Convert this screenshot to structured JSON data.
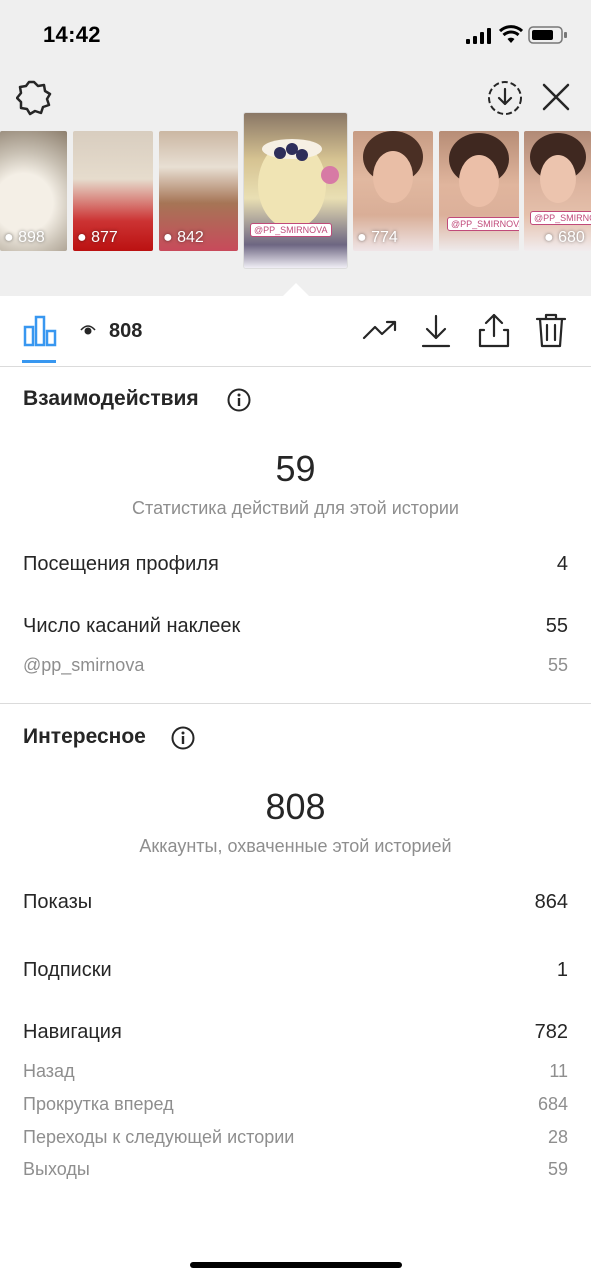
{
  "status_bar": {
    "time": "14:42"
  },
  "thumbnails": [
    {
      "views": "898"
    },
    {
      "views": "877"
    },
    {
      "views": "842"
    },
    {
      "views": "",
      "sticker": "@PP_SMIRNOVA",
      "selected": true
    },
    {
      "views": "774"
    },
    {
      "views": "",
      "sticker": "@PP_SMIRNOVA"
    },
    {
      "views": "680",
      "sticker": "@PP_SMIRNOVA"
    }
  ],
  "toolbar": {
    "view_count": "808"
  },
  "interactions": {
    "title": "Взаимодействия",
    "total": "59",
    "subtitle": "Статистика действий для этой истории",
    "rows": [
      {
        "label": "Посещения профиля",
        "value": "4"
      },
      {
        "label": "Число касаний наклеек",
        "value": "55"
      }
    ],
    "sub_rows": [
      {
        "label": "@pp_smirnova",
        "value": "55"
      }
    ]
  },
  "discovery": {
    "title": "Интересное",
    "total": "808",
    "subtitle": "Аккаунты, охваченные этой историей",
    "rows": [
      {
        "label": "Показы",
        "value": "864"
      },
      {
        "label": "Подписки",
        "value": "1"
      },
      {
        "label": "Навигация",
        "value": "782"
      }
    ],
    "sub_rows": [
      {
        "label": "Назад",
        "value": "11"
      },
      {
        "label": "Прокрутка вперед",
        "value": "684"
      },
      {
        "label": "Переходы к следующей истории",
        "value": "28"
      },
      {
        "label": "Выходы",
        "value": "59"
      }
    ]
  },
  "colors": {
    "accent": "#3897f0",
    "muted": "#8e8e8e",
    "text": "#262626"
  }
}
